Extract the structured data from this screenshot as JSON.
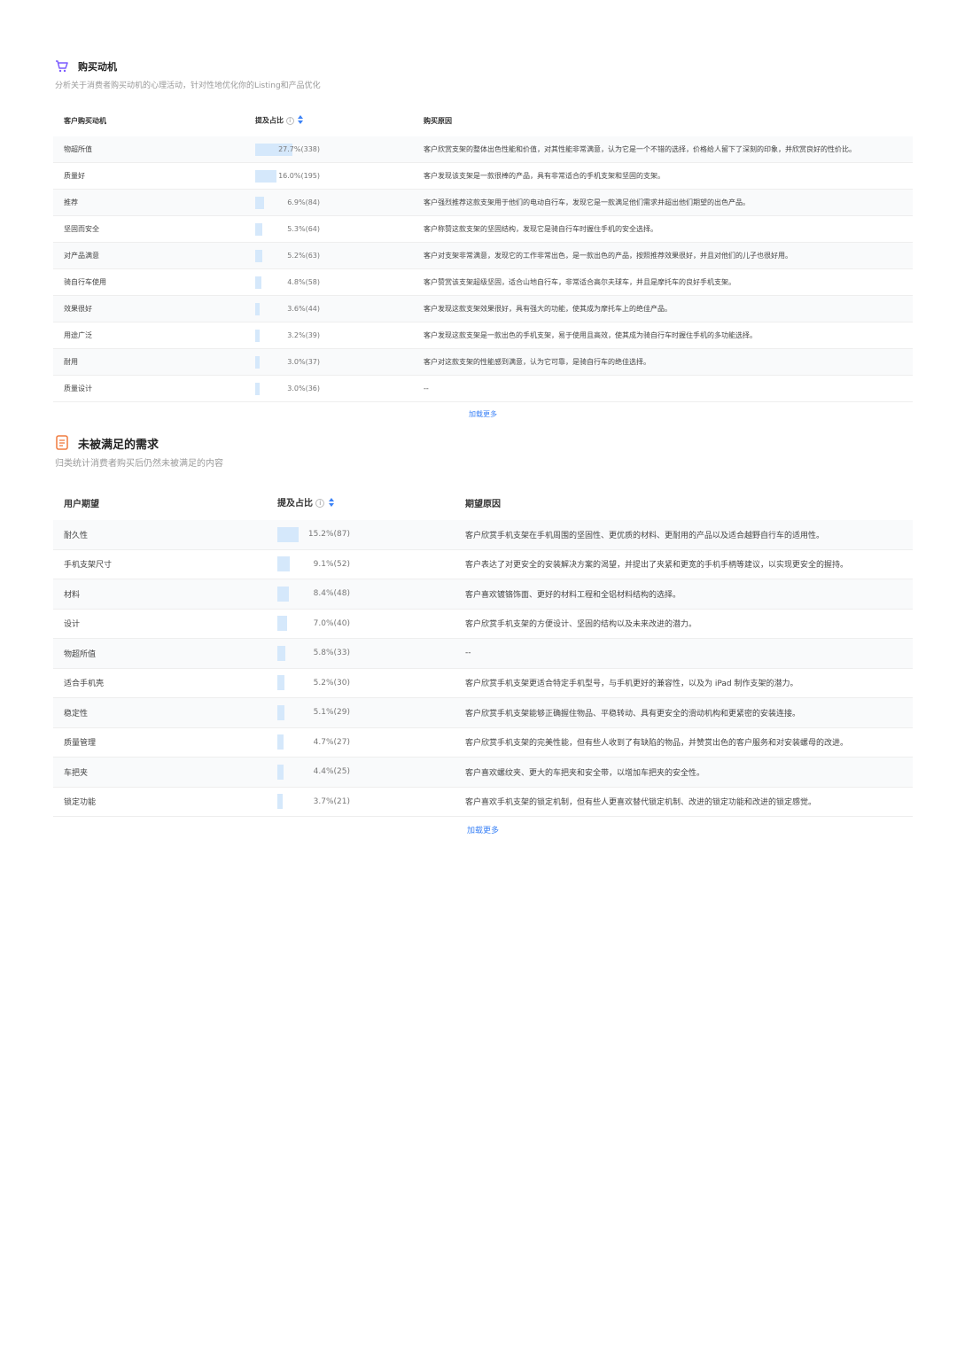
{
  "motivation": {
    "title": "购买动机",
    "subtitle": "分析关于消费者购买动机的心理活动，针对性地优化你的Listing和产品优化",
    "col_name": "客户购买动机",
    "col_pct": "提及占比",
    "col_reason": "购买原因",
    "load_more": "加载更多",
    "rows": [
      {
        "name": "物超所值",
        "pct": "27.7%(338)",
        "frac": 0.277,
        "reason": "客户欣赏支架的整体出色性能和价值，对其性能非常满意，认为它是一个不错的选择，价格给人留下了深刻的印象，并欣赏良好的性价比。"
      },
      {
        "name": "质量好",
        "pct": "16.0%(195)",
        "frac": 0.16,
        "reason": "客户发现该支架是一款很棒的产品，具有非常适合的手机支架和坚固的支架。"
      },
      {
        "name": "推荐",
        "pct": "6.9%(84)",
        "frac": 0.069,
        "reason": "客户强烈推荐这款支架用于他们的电动自行车，发现它是一款满足他们需求并超出他们期望的出色产品。"
      },
      {
        "name": "坚固而安全",
        "pct": "5.3%(64)",
        "frac": 0.053,
        "reason": "客户称赞这款支架的坚固结构，发现它是骑自行车时握住手机的安全选择。"
      },
      {
        "name": "对产品满意",
        "pct": "5.2%(63)",
        "frac": 0.052,
        "reason": "客户对支架非常满意，发现它的工作非常出色，是一款出色的产品，按照推荐效果很好，并且对他们的儿子也很好用。"
      },
      {
        "name": "骑自行车使用",
        "pct": "4.8%(58)",
        "frac": 0.048,
        "reason": "客户赞赏该支架超级坚固，适合山地自行车，非常适合高尔夫球车，并且是摩托车的良好手机支架。"
      },
      {
        "name": "效果很好",
        "pct": "3.6%(44)",
        "frac": 0.036,
        "reason": "客户发现这款支架效果很好，具有强大的功能，使其成为摩托车上的绝佳产品。"
      },
      {
        "name": "用途广泛",
        "pct": "3.2%(39)",
        "frac": 0.032,
        "reason": "客户发现这款支架是一款出色的手机支架，易于使用且高效，使其成为骑自行车时握住手机的多功能选择。"
      },
      {
        "name": "耐用",
        "pct": "3.0%(37)",
        "frac": 0.03,
        "reason": "客户对这款支架的性能感到满意，认为它可靠，是骑自行车的绝佳选择。"
      },
      {
        "name": "质量设计",
        "pct": "3.0%(36)",
        "frac": 0.03,
        "reason": "--"
      }
    ]
  },
  "unmet": {
    "title": "未被满足的需求",
    "subtitle": "归类统计消费者购买后仍然未被满足的内容",
    "col_name": "用户期望",
    "col_pct": "提及占比",
    "col_reason": "期望原因",
    "load_more": "加载更多",
    "rows": [
      {
        "name": "耐久性",
        "pct": "15.2%(87)",
        "frac": 0.152,
        "reason": "客户欣赏手机支架在手机周围的坚固性、更优质的材料、更耐用的产品以及适合越野自行车的适用性。"
      },
      {
        "name": "手机支架尺寸",
        "pct": "9.1%(52)",
        "frac": 0.091,
        "reason": "客户表达了对更安全的安装解决方案的渴望，并提出了夹紧和更宽的手机手柄等建议，以实现更安全的握持。"
      },
      {
        "name": "材料",
        "pct": "8.4%(48)",
        "frac": 0.084,
        "reason": "客户喜欢镀铬饰面、更好的材料工程和全铝材料结构的选择。"
      },
      {
        "name": "设计",
        "pct": "7.0%(40)",
        "frac": 0.07,
        "reason": "客户欣赏手机支架的方便设计、坚固的结构以及未来改进的潜力。"
      },
      {
        "name": "物超所值",
        "pct": "5.8%(33)",
        "frac": 0.058,
        "reason": "--"
      },
      {
        "name": "适合手机壳",
        "pct": "5.2%(30)",
        "frac": 0.052,
        "reason": "客户欣赏手机支架更适合特定手机型号，与手机更好的兼容性，以及为 iPad 制作支架的潜力。"
      },
      {
        "name": "稳定性",
        "pct": "5.1%(29)",
        "frac": 0.051,
        "reason": "客户欣赏手机支架能够正确握住物品、平稳转动、具有更安全的滑动机构和更紧密的安装连接。"
      },
      {
        "name": "质量管理",
        "pct": "4.7%(27)",
        "frac": 0.047,
        "reason": "客户欣赏手机支架的完美性能，但有些人收到了有缺陷的物品，并赞赏出色的客户服务和对安装螺母的改进。"
      },
      {
        "name": "车把夹",
        "pct": "4.4%(25)",
        "frac": 0.044,
        "reason": "客户喜欢螺纹夹、更大的车把夹和安全带，以增加车把夹的安全性。"
      },
      {
        "name": "锁定功能",
        "pct": "3.7%(21)",
        "frac": 0.037,
        "reason": "客户喜欢手机支架的锁定机制，但有些人更喜欢替代锁定机制、改进的锁定功能和改进的锁定感觉。"
      }
    ]
  },
  "colors": {
    "bar": "#d5e8fb",
    "accent": "#3b82f6",
    "cart_icon": "#7c5cff",
    "doc_icon": "#f07b3f"
  }
}
